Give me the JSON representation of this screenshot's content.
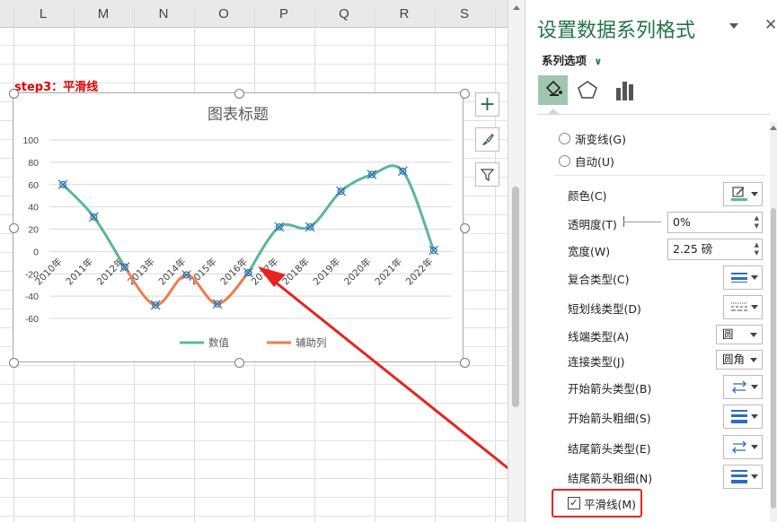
{
  "sheet": {
    "columns": [
      "L",
      "M",
      "N",
      "O",
      "P",
      "Q",
      "R",
      "S"
    ]
  },
  "annotation": {
    "step_label": "step3：平滑线"
  },
  "chart": {
    "title": "图表标题",
    "legend": [
      {
        "name": "数值",
        "color": "#5bb796"
      },
      {
        "name": "辅助列",
        "color": "#ee7c4d"
      }
    ]
  },
  "chart_data": {
    "type": "line",
    "title": "图表标题",
    "categories": [
      "2010年",
      "2011年",
      "2012年",
      "2013年",
      "2014年",
      "2015年",
      "2016年",
      "2017年",
      "2018年",
      "2019年",
      "2020年",
      "2021年",
      "2022年"
    ],
    "ylim": [
      -60,
      100
    ],
    "yticks": [
      100,
      80,
      60,
      40,
      20,
      0,
      -20,
      -40,
      -60
    ],
    "grid": true,
    "legend_position": "bottom",
    "smooth": true,
    "series": [
      {
        "name": "数值",
        "color": "#5bb796",
        "values": [
          60,
          31,
          -14,
          null,
          null,
          null,
          -19,
          22,
          22,
          54,
          69,
          72,
          1
        ]
      },
      {
        "name": "辅助列",
        "color": "#ee7c4d",
        "values": [
          null,
          null,
          -14,
          -48,
          -21,
          -47,
          -19,
          null,
          null,
          null,
          null,
          null,
          null
        ]
      }
    ]
  },
  "chart_tools": {
    "add_element": "+",
    "style": "brush-icon",
    "filter": "filter-icon"
  },
  "pane": {
    "title": "设置数据系列格式",
    "section": "系列选项",
    "tabs": [
      "fill-line-icon",
      "effects-icon",
      "series-options-icon"
    ],
    "gradient_line": "渐变线(G)",
    "auto": "自动(U)",
    "color": "颜色(C)",
    "transparency": "透明度(T)",
    "transparency_value": "0%",
    "width": "宽度(W)",
    "width_value": "2.25 磅",
    "compound_type": "复合类型(C)",
    "dash_type": "短划线类型(D)",
    "cap_type": "线端类型(A)",
    "cap_value": "圆",
    "join_type": "连接类型(J)",
    "join_value": "圆角",
    "begin_arrow_type": "开始箭头类型(B)",
    "begin_arrow_size": "开始箭头粗细(S)",
    "end_arrow_type": "结尾箭头类型(E)",
    "end_arrow_size": "结尾箭头粗细(N)",
    "smooth_line": "平滑线(M)",
    "smooth_checked": true
  },
  "colors": {
    "excel_green": "#217346",
    "highlight_red": "#e52421",
    "series_green": "#5bb796",
    "series_orange": "#ee7c4d"
  }
}
